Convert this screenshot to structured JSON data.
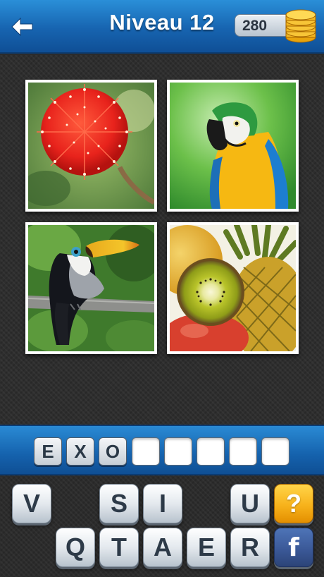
{
  "header": {
    "back_icon": "left-arrow-icon",
    "title": "Niveau 12",
    "coins": "280",
    "coin_icon": "gold-coin-stack-icon"
  },
  "puzzle": {
    "images": [
      {
        "subject": "red-flower"
      },
      {
        "subject": "macaw-parrot"
      },
      {
        "subject": "toucan"
      },
      {
        "subject": "tropical-fruit"
      }
    ]
  },
  "answer": {
    "slots": [
      "E",
      "X",
      "O",
      "",
      "",
      "",
      "",
      ""
    ]
  },
  "keyboard": {
    "row1": [
      "V",
      "S",
      "I",
      "U"
    ],
    "row2": [
      "Q",
      "T",
      "A",
      "E",
      "R"
    ],
    "hint_label": "?",
    "facebook_label": "f"
  },
  "colors": {
    "header_blue": "#1764b0",
    "hint_gold": "#f7b21b",
    "facebook_blue": "#3b5998"
  }
}
